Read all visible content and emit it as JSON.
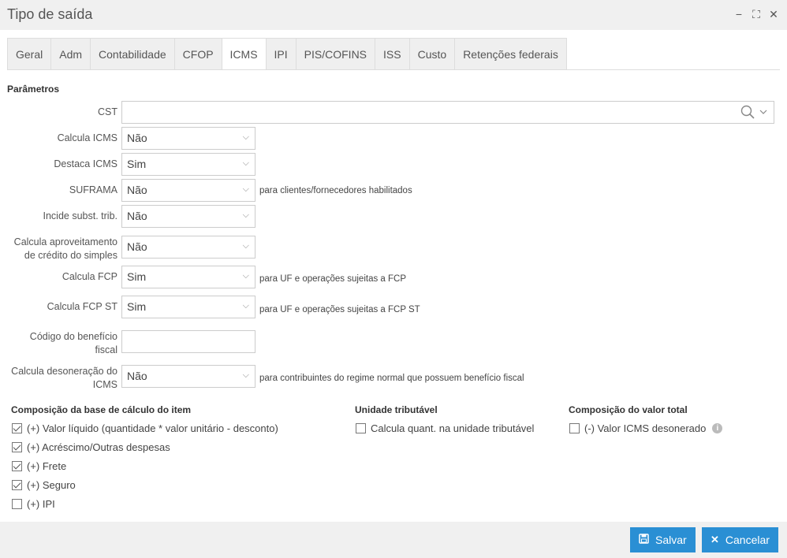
{
  "window": {
    "title": "Tipo de saída",
    "minimize_icon": "−",
    "maximize_icon": "⛶",
    "close_icon": "✕"
  },
  "tabs": [
    "Geral",
    "Adm",
    "Contabilidade",
    "CFOP",
    "ICMS",
    "IPI",
    "PIS/COFINS",
    "ISS",
    "Custo",
    "Retenções federais"
  ],
  "active_tab": "ICMS",
  "params": {
    "section_title": "Parâmetros",
    "cst_label": "CST",
    "cst_value": "",
    "calcula_icms_label": "Calcula ICMS",
    "calcula_icms_value": "Não",
    "destaca_icms_label": "Destaca ICMS",
    "destaca_icms_value": "Sim",
    "suframa_label": "SUFRAMA",
    "suframa_value": "Não",
    "suframa_hint": "para clientes/fornecedores habilitados",
    "incide_st_label": "Incide subst. trib.",
    "incide_st_value": "Não",
    "aproveitamento_label_1": "Calcula aproveitamento",
    "aproveitamento_label_2": "de crédito do simples",
    "aproveitamento_value": "Não",
    "calcula_fcp_label": "Calcula FCP",
    "calcula_fcp_value": "Sim",
    "calcula_fcp_hint": "para UF e operações sujeitas a FCP",
    "calcula_fcp_st_label": "Calcula FCP ST",
    "calcula_fcp_st_value": "Sim",
    "calcula_fcp_st_hint": "para UF e operações sujeitas a FCP ST",
    "beneficio_label_1": "Código do benefício",
    "beneficio_label_2": "fiscal",
    "beneficio_value": "",
    "desoneracao_label_1": "Calcula desoneração do",
    "desoneracao_label_2": "ICMS",
    "desoneracao_value": "Não",
    "desoneracao_hint": "para contribuintes do regime normal que possuem benefício fiscal"
  },
  "composicao_base": {
    "title": "Composição da base de cálculo do item",
    "items": [
      {
        "label": "(+) Valor líquido (quantidade * valor unitário - desconto)",
        "checked": true
      },
      {
        "label": "(+) Acréscimo/Outras despesas",
        "checked": true
      },
      {
        "label": "(+) Frete",
        "checked": true
      },
      {
        "label": "(+) Seguro",
        "checked": true
      },
      {
        "label": "(+) IPI",
        "checked": false
      }
    ]
  },
  "unidade_tributavel": {
    "title": "Unidade tributável",
    "item": {
      "label": "Calcula quant. na unidade tributável",
      "checked": false
    }
  },
  "composicao_total": {
    "title": "Composição do valor total",
    "item": {
      "label": "(-) Valor ICMS desonerado",
      "checked": false
    }
  },
  "buttons": {
    "save": "Salvar",
    "cancel": "Cancelar"
  },
  "colors": {
    "accent": "#2a8fd4",
    "titlebar": "#f0f0f0"
  }
}
